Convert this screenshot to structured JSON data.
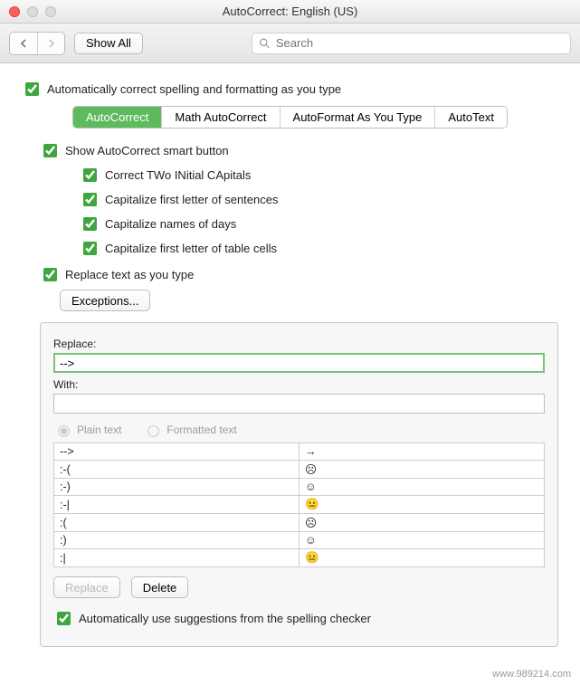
{
  "window": {
    "title": "AutoCorrect: English (US)"
  },
  "toolbar": {
    "show_all": "Show All",
    "search_placeholder": "Search"
  },
  "tabs": {
    "autocorrect": "AutoCorrect",
    "math": "Math AutoCorrect",
    "autoformat": "AutoFormat As You Type",
    "autotext": "AutoText"
  },
  "checks": {
    "auto_correct_typing": "Automatically correct spelling and formatting as you type",
    "smart_button": "Show AutoCorrect smart button",
    "two_initial": "Correct TWo INitial CApitals",
    "sentences": "Capitalize first letter of sentences",
    "days": "Capitalize names of days",
    "table_cells": "Capitalize first letter of table cells",
    "replace_as_type": "Replace text as you type",
    "use_spelling": "Automatically use suggestions from the spelling checker"
  },
  "buttons": {
    "exceptions": "Exceptions...",
    "replace": "Replace",
    "delete": "Delete"
  },
  "fields": {
    "replace_label": "Replace:",
    "replace_value": "-->",
    "with_label": "With:",
    "with_value": ""
  },
  "radios": {
    "plain": "Plain text",
    "formatted": "Formatted text"
  },
  "table": {
    "rows": [
      {
        "from": "-->",
        "to": "→"
      },
      {
        "from": ":-(",
        "to": "☹"
      },
      {
        "from": ":-)",
        "to": "☺"
      },
      {
        "from": ":-|",
        "to": "😐"
      },
      {
        "from": ":(",
        "to": "☹"
      },
      {
        "from": ":)",
        "to": "☺"
      },
      {
        "from": ":|",
        "to": "😐"
      }
    ]
  },
  "watermark": "www.989214.com"
}
